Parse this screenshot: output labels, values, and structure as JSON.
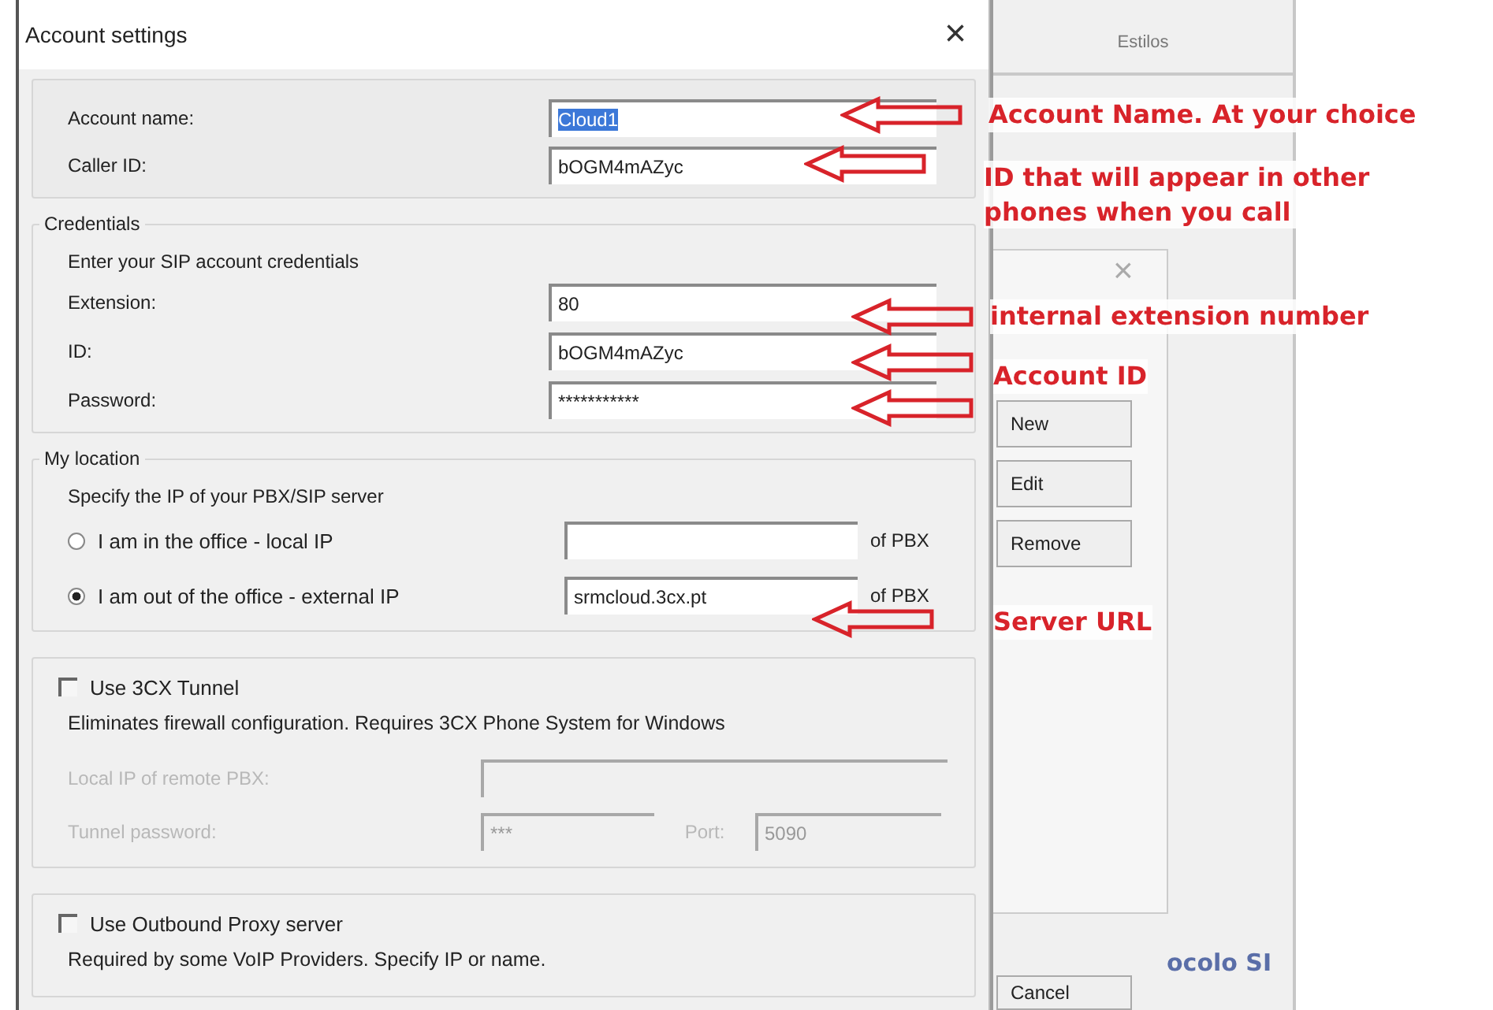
{
  "dialog": {
    "title": "Account settings",
    "close_glyph": "×",
    "account": {
      "rows": [
        {
          "label": "Account name:",
          "value": "Cloud1",
          "highlighted": true
        },
        {
          "label": "Caller ID:",
          "value": "bOGM4mAZyc",
          "highlighted": false
        }
      ]
    },
    "credentials": {
      "legend": "Credentials",
      "hint": "Enter your SIP account credentials",
      "rows": [
        {
          "label": "Extension:",
          "value": "80",
          "highlighted": false
        },
        {
          "label": "ID:",
          "value": "bOGM4mAZyc",
          "highlighted": false
        },
        {
          "label": "Password:",
          "value": "***********",
          "highlighted": false
        }
      ]
    },
    "location": {
      "legend": "My location",
      "hint": "Specify the IP of your PBX/SIP server",
      "options": [
        {
          "label": "I am in the office - local IP",
          "selected": false,
          "suffix": "of PBX"
        },
        {
          "label": "I am out of the office - external IP",
          "selected": true,
          "value": "srmcloud.3cx.pt",
          "suffix": "of PBX"
        }
      ]
    },
    "tunnel": {
      "label": "Use 3CX Tunnel",
      "checked": false,
      "hint": "Eliminates firewall configuration. Requires 3CX Phone System for Windows",
      "disabled": true,
      "local_ip_label": "Local IP of remote PBX:",
      "password_label": "Tunnel password:",
      "password_value": "***",
      "port_label": "Port:",
      "port_value": "5090"
    },
    "proxy": {
      "label": "Use Outbound Proxy server",
      "checked": false,
      "hint": "Required by some VoIP Providers. Specify IP or name."
    }
  },
  "background_window": {
    "header": "Estilos",
    "close_glyph": "×",
    "buttons": [
      "New",
      "Edit",
      "Remove",
      "Cancel"
    ],
    "link_text": "ocolo SI"
  },
  "annotations": [
    {
      "text": "Account Name. At your choice"
    },
    {
      "text": "ID that will appear in other phones when you call"
    },
    {
      "text": "internal extension number"
    },
    {
      "text": "Account ID"
    },
    {
      "text": "Server URL"
    }
  ]
}
